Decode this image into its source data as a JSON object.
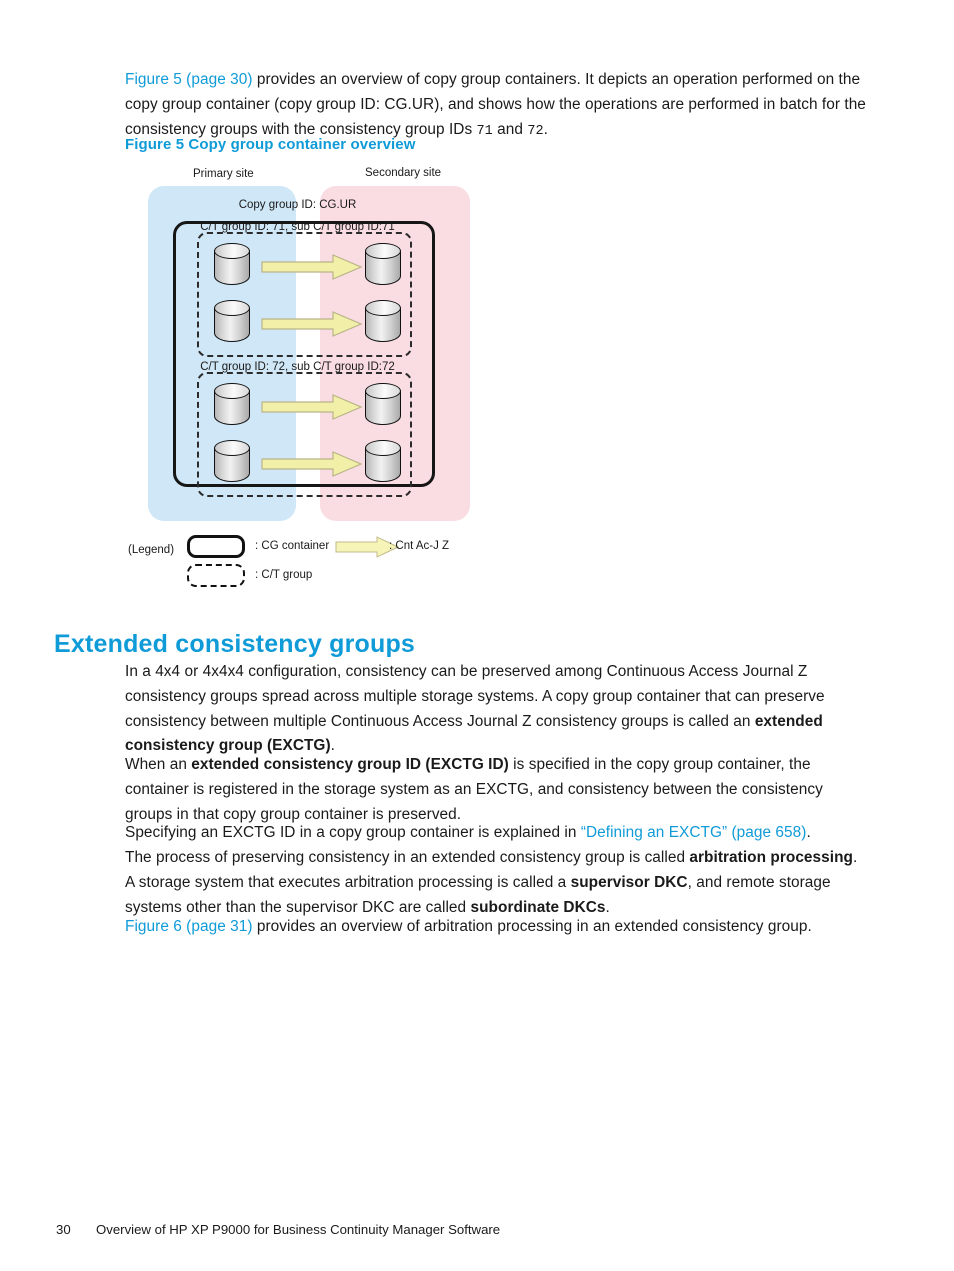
{
  "document": {
    "intro": {
      "link_text": "Figure 5 (page 30)",
      "text_part_1": " provides an overview of copy group containers. It depicts an operation performed on the copy group container (copy group ID: CG.UR), and shows how the operations are performed in batch for the consistency groups with the consistency group IDs ",
      "mono_1": "71",
      "text_part_2": " and ",
      "mono_2": "72",
      "text_part_3": "."
    },
    "figure_caption": "Figure 5 Copy group container overview",
    "figure": {
      "primary_site_label": "Primary site",
      "secondary_site_label": "Secondary site",
      "copy_group_title": "Copy group ID: CG.UR",
      "ct_group_1_label": "C/T group ID: 71, sub C/T group ID:71",
      "ct_group_2_label": "C/T group ID: 72, sub C/T group ID:72",
      "legend": {
        "title": "(Legend)",
        "cg_container_text": ": CG container",
        "ct_group_text": ": C/T group",
        "arrow_text": ": Cnt Ac-J Z"
      },
      "colors": {
        "primary_site_fill": "#cfe7f7",
        "secondary_site_fill": "#fadde2",
        "arrow_fill": "#f2f0a8",
        "container_border": "#161616"
      }
    },
    "section": {
      "heading": "Extended consistency groups",
      "para_1_a": "In a 4x4 or 4x4x4 configuration, consistency can be preserved among Continuous Access Journal Z consistency groups spread across multiple storage systems. A copy group container that can preserve consistency between multiple Continuous Access Journal Z consistency groups is called an ",
      "para_1_b": "extended consistency group (EXCTG)",
      "para_1_c": ".",
      "para_2_a": "When an ",
      "para_2_b": "extended consistency group ID (EXCTG ID)",
      "para_2_c": " is specified in the copy group container, the container is registered in the storage system as an EXCTG, and consistency between the consistency groups in that copy group container is preserved.",
      "para_3_a": "Specifying an EXCTG ID in a copy group container is explained in ",
      "para_3_link": "“Defining an EXCTG” (page 658)",
      "para_3_c": ".",
      "para_4_a": "The process of preserving consistency in an extended consistency group is called ",
      "para_4_b": "arbitration processing",
      "para_4_c": ". A storage system that executes arbitration processing is called a ",
      "para_4_d": "supervisor DKC",
      "para_4_e": ", and remote storage systems other than the supervisor DKC are called ",
      "para_4_f": "subordinate DKCs",
      "para_4_g": ".",
      "para_5_link": "Figure 6 (page 31)",
      "para_5_text": " provides an overview of arbitration processing in an extended consistency group."
    },
    "footer": {
      "page_number": "30",
      "chapter_title": "Overview of HP XP P9000 for Business Continuity Manager Software"
    },
    "theme": {
      "link_color": "#0f9bd7",
      "heading_color": "#0f9bd7",
      "text_color": "#1a1a1a"
    }
  }
}
